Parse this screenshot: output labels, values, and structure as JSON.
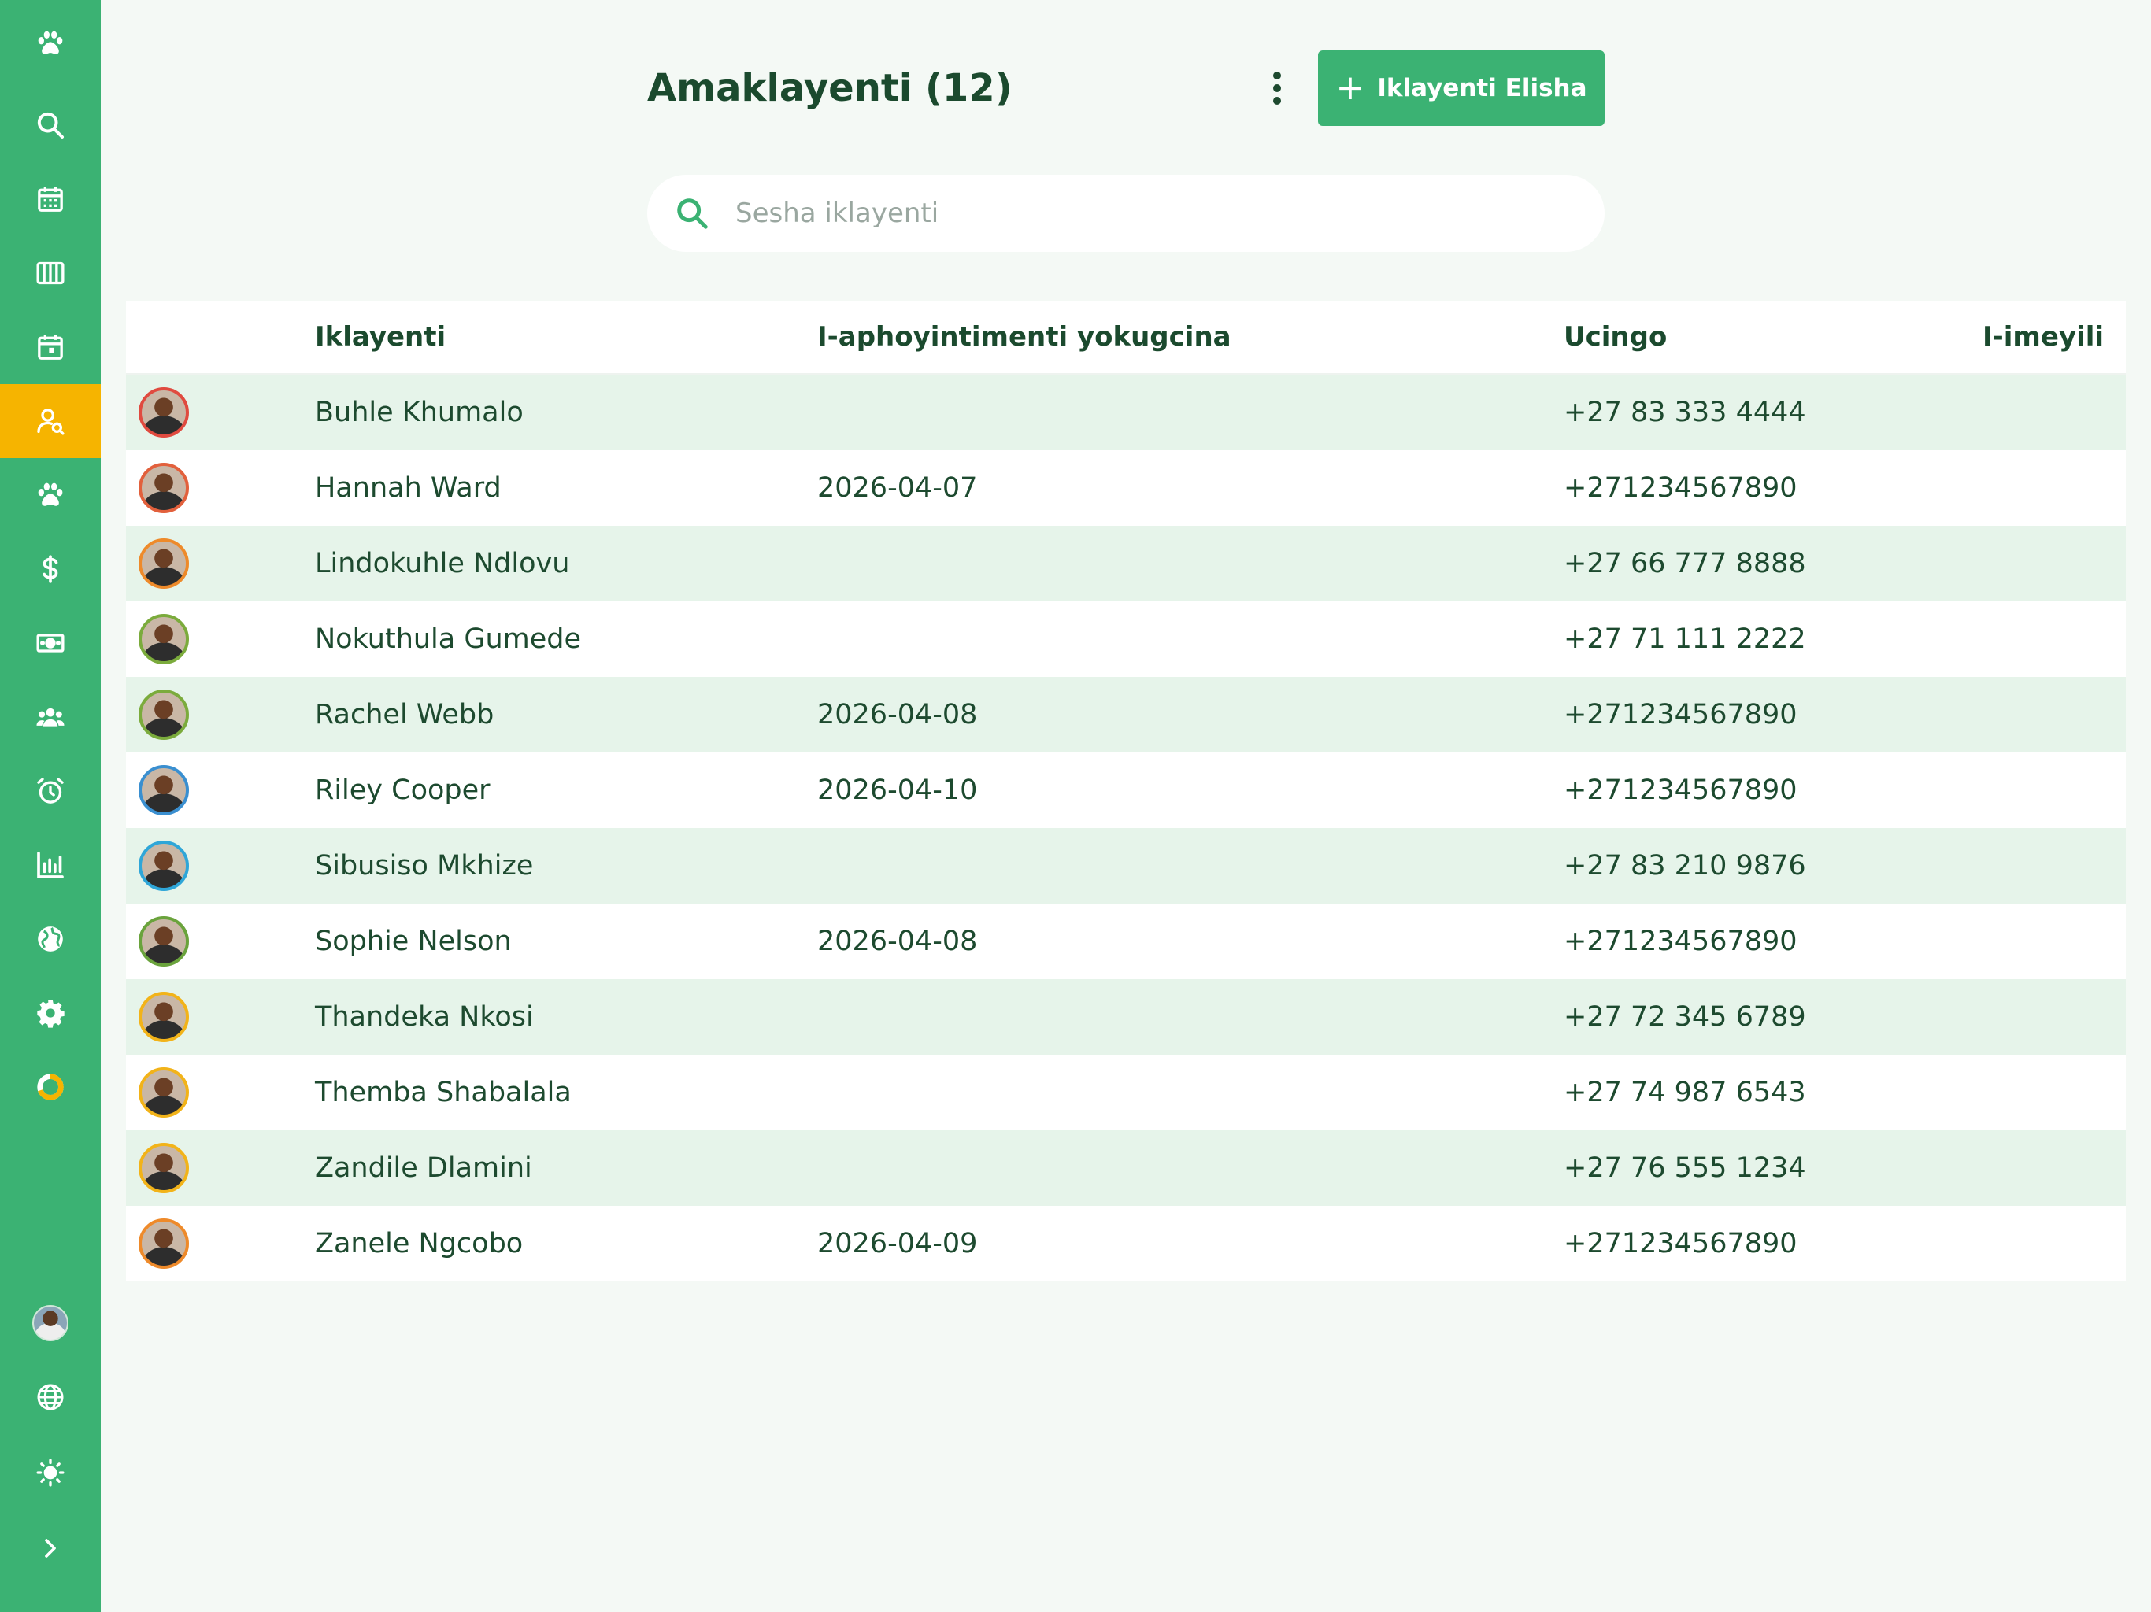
{
  "colors": {
    "brand": "#3bb273",
    "active_nav": "#f6b400",
    "row_tint": "#e6f4ea",
    "text": "#1d4a2f"
  },
  "sidebar": {
    "items": [
      {
        "icon": "paw-icon",
        "active": false
      },
      {
        "icon": "search-icon",
        "active": false
      },
      {
        "icon": "calendar-icon",
        "active": false
      },
      {
        "icon": "columns-icon",
        "active": false
      },
      {
        "icon": "calendar-day-icon",
        "active": false
      },
      {
        "icon": "user-search-icon",
        "active": true
      },
      {
        "icon": "paw-icon",
        "active": false
      },
      {
        "icon": "dollar-icon",
        "active": false
      },
      {
        "icon": "banknote-icon",
        "active": false
      },
      {
        "icon": "users-icon",
        "active": false
      },
      {
        "icon": "alarm-clock-icon",
        "active": false
      },
      {
        "icon": "bar-chart-icon",
        "active": false
      },
      {
        "icon": "globe-icon",
        "active": false
      },
      {
        "icon": "gear-icon",
        "active": false
      },
      {
        "icon": "progress-ring-icon",
        "active": false
      }
    ],
    "bottom": [
      {
        "icon": "user-avatar"
      },
      {
        "icon": "language-globe-icon"
      },
      {
        "icon": "sun-icon"
      },
      {
        "icon": "chevron-right-icon"
      }
    ]
  },
  "header": {
    "title": "Amaklayenti (12)",
    "add_button_label": "Iklayenti Elisha",
    "more_icon": "more-vertical-icon"
  },
  "search": {
    "placeholder": "Sesha iklayenti",
    "value": ""
  },
  "table": {
    "columns": [
      "Iklayenti",
      "I-aphoyintimenti yokugcina",
      "Ucingo",
      "I-imeyili"
    ],
    "rows": [
      {
        "name": "Buhle Khumalo",
        "last_appointment": "",
        "phone": "+27 83 333 4444",
        "email": "",
        "avatar_ring": "#e04a3f"
      },
      {
        "name": "Hannah Ward",
        "last_appointment": "2026-04-07",
        "phone": "+271234567890",
        "email": "",
        "avatar_ring": "#e2603c"
      },
      {
        "name": "Lindokuhle Ndlovu",
        "last_appointment": "",
        "phone": "+27 66 777 8888",
        "email": "",
        "avatar_ring": "#ee8a2a"
      },
      {
        "name": "Nokuthula Gumede",
        "last_appointment": "",
        "phone": "+27 71 111 2222",
        "email": "",
        "avatar_ring": "#7bab3c"
      },
      {
        "name": "Rachel Webb",
        "last_appointment": "2026-04-08",
        "phone": "+271234567890",
        "email": "",
        "avatar_ring": "#7bab3c"
      },
      {
        "name": "Riley Cooper",
        "last_appointment": "2026-04-10",
        "phone": "+271234567890",
        "email": "",
        "avatar_ring": "#3a8fd0"
      },
      {
        "name": "Sibusiso Mkhize",
        "last_appointment": "",
        "phone": "+27 83 210 9876",
        "email": "",
        "avatar_ring": "#2fa6d8"
      },
      {
        "name": "Sophie Nelson",
        "last_appointment": "2026-04-08",
        "phone": "+271234567890",
        "email": "",
        "avatar_ring": "#6aa33c"
      },
      {
        "name": "Thandeka Nkosi",
        "last_appointment": "",
        "phone": "+27 72 345 6789",
        "email": "",
        "avatar_ring": "#f2b319"
      },
      {
        "name": "Themba Shabalala",
        "last_appointment": "",
        "phone": "+27 74 987 6543",
        "email": "",
        "avatar_ring": "#f2b319"
      },
      {
        "name": "Zandile Dlamini",
        "last_appointment": "",
        "phone": "+27 76 555 1234",
        "email": "",
        "avatar_ring": "#f2b319"
      },
      {
        "name": "Zanele Ngcobo",
        "last_appointment": "2026-04-09",
        "phone": "+271234567890",
        "email": "",
        "avatar_ring": "#ee8a2a"
      }
    ]
  }
}
